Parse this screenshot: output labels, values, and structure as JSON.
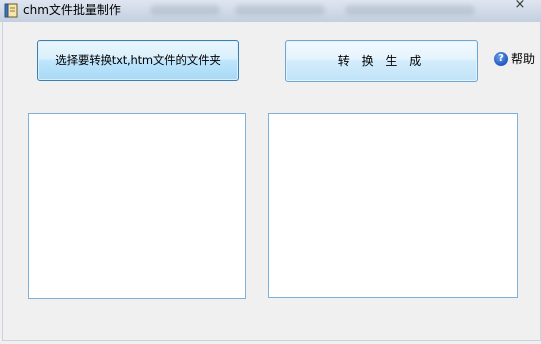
{
  "window": {
    "title": "chm文件批量制作",
    "icon": "book-icon",
    "close_glyph": "×"
  },
  "toolbar": {
    "select_folder_label": "选择要转换txt,htm文件的文件夹",
    "convert_label": "转 换 生 成",
    "help_icon": "question-circle-icon",
    "help_icon_glyph": "?",
    "help_label": "帮助"
  },
  "lists": {
    "left": {
      "items": []
    },
    "right": {
      "items": []
    }
  },
  "colors": {
    "accent_border": "#3c7fb1",
    "listbox_border": "#7fb1d8",
    "client_background": "#f0f0f0"
  }
}
